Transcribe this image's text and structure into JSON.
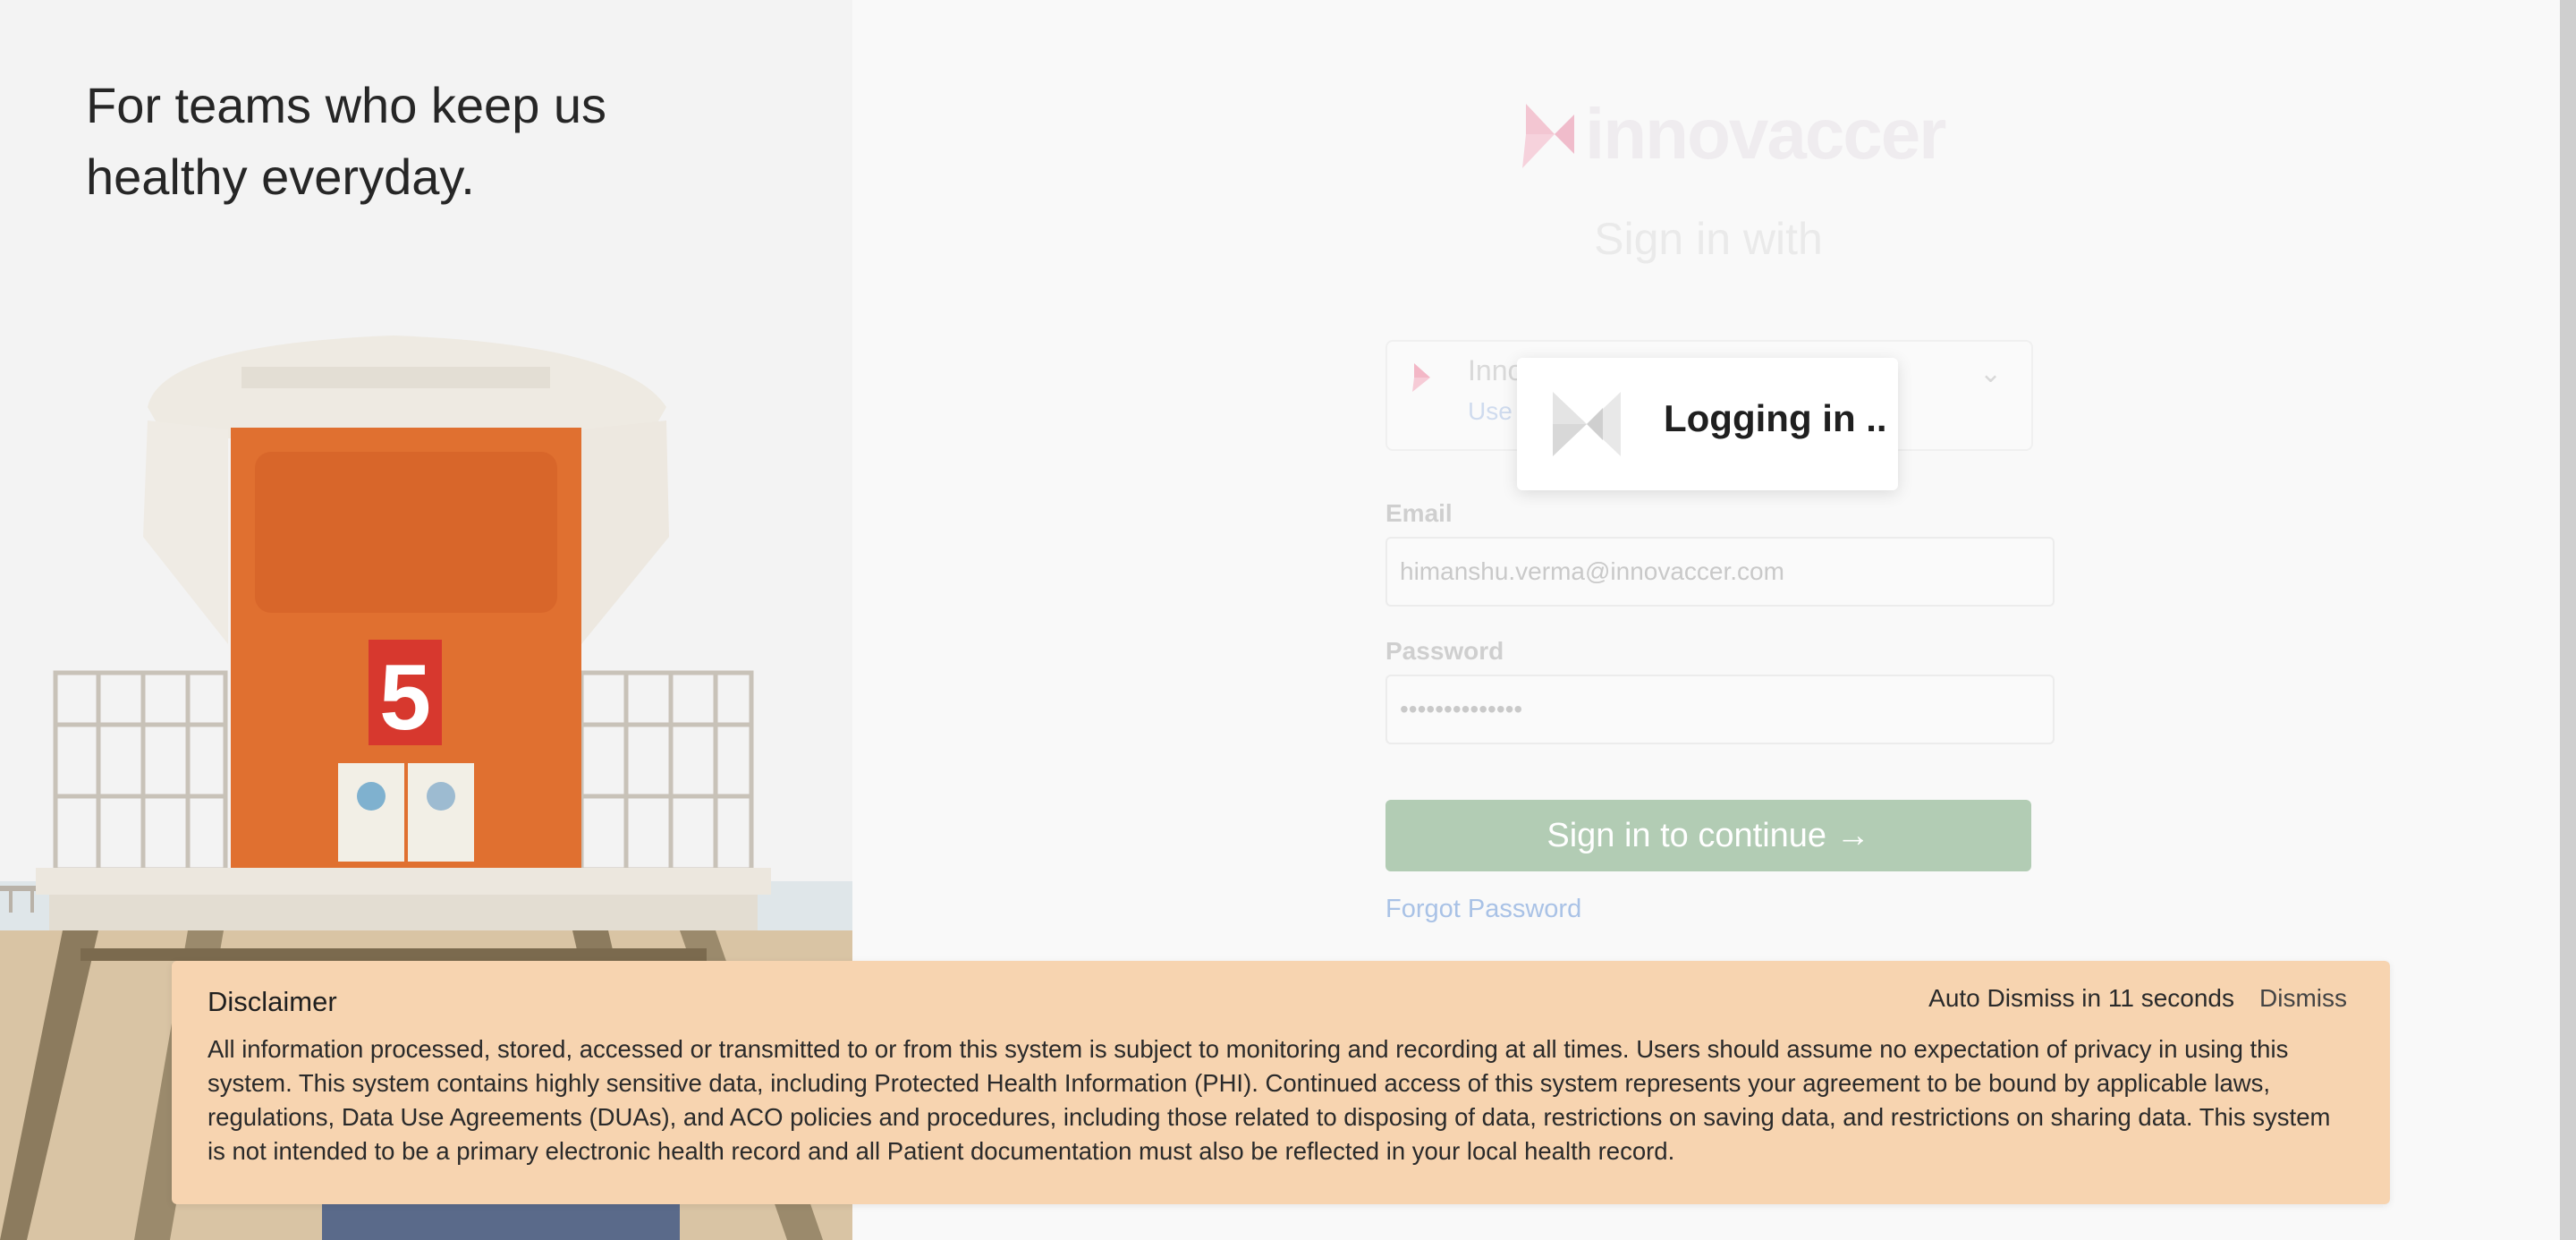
{
  "hero": {
    "tagline_line1": "For teams who keep us",
    "tagline_line2": "healthy everyday.",
    "tower_number": "5"
  },
  "brand": {
    "logo_text": "innovaccer",
    "accent_color": "#e8426a"
  },
  "login": {
    "heading": "Sign in with",
    "provider": {
      "name": "Inno",
      "sub": "Use"
    },
    "email": {
      "label": "Email",
      "value": "himanshu.verma@innovaccer.com"
    },
    "password": {
      "label": "Password",
      "value": "••••••••••••••"
    },
    "submit_label": "Sign in to continue →",
    "submit_color": "#b2ccb4",
    "forgot_label": "Forgot Password"
  },
  "toast": {
    "text": "Logging in .."
  },
  "disclaimer": {
    "title": "Disclaimer",
    "timer_text": "Auto Dismiss in 11 seconds",
    "dismiss_label": "Dismiss",
    "background_color": "#f7d4b0",
    "body": "All information processed, stored, accessed or transmitted to or from this system is subject to monitoring and recording at all times. Users should assume no expectation of privacy in using this system. This system contains highly sensitive data, including Protected Health Information (PHI). Continued access of this system represents your agreement to be bound by applicable laws, regulations, Data Use Agreements (DUAs), and ACO policies and procedures, including those related to disposing of data, restrictions on saving data, and restrictions on sharing data. This system is not intended to be a primary electronic health record and all Patient documentation must also be reflected in your local health record."
  }
}
